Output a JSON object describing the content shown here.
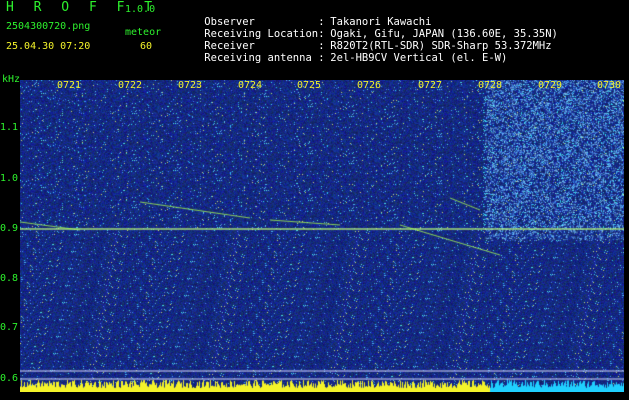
{
  "header": {
    "app_title": "H R O F F T",
    "app_version": "1.0.0",
    "file_name": "2504300720.png",
    "meteor_label": "meteor",
    "datetime": "25.04.30 07:20",
    "meteor_count": "60"
  },
  "info": [
    {
      "key": "Observer",
      "sep": ":",
      "value": "Takanori Kawachi"
    },
    {
      "key": "Receiving Location",
      "sep": ":",
      "value": "Ogaki, Gifu, JAPAN (136.60E, 35.35N)"
    },
    {
      "key": "Receiver",
      "sep": ":",
      "value": "R820T2(RTL-SDR) SDR-Sharp 53.372MHz"
    },
    {
      "key": "Receiving antenna",
      "sep": ":",
      "value": "2el-HB9CV Vertical (el. E-W)"
    }
  ],
  "axis": {
    "y_unit": "kHz",
    "y_ticks": [
      "1.1",
      "1.0",
      "0.9",
      "0.8",
      "0.7",
      "0.6"
    ],
    "x_ticks": [
      "0721",
      "0722",
      "0723",
      "0724",
      "0725",
      "0726",
      "0727",
      "0728",
      "0729",
      "0730"
    ]
  },
  "colors": {
    "background": "#000000",
    "noise_base": "#101a8c",
    "signal": "#b8ff40",
    "text_green": "#2df22d",
    "text_yellow": "#f4f42a",
    "meter_yellow": "#f4f42a",
    "meter_cyan": "#20d0ff"
  }
}
